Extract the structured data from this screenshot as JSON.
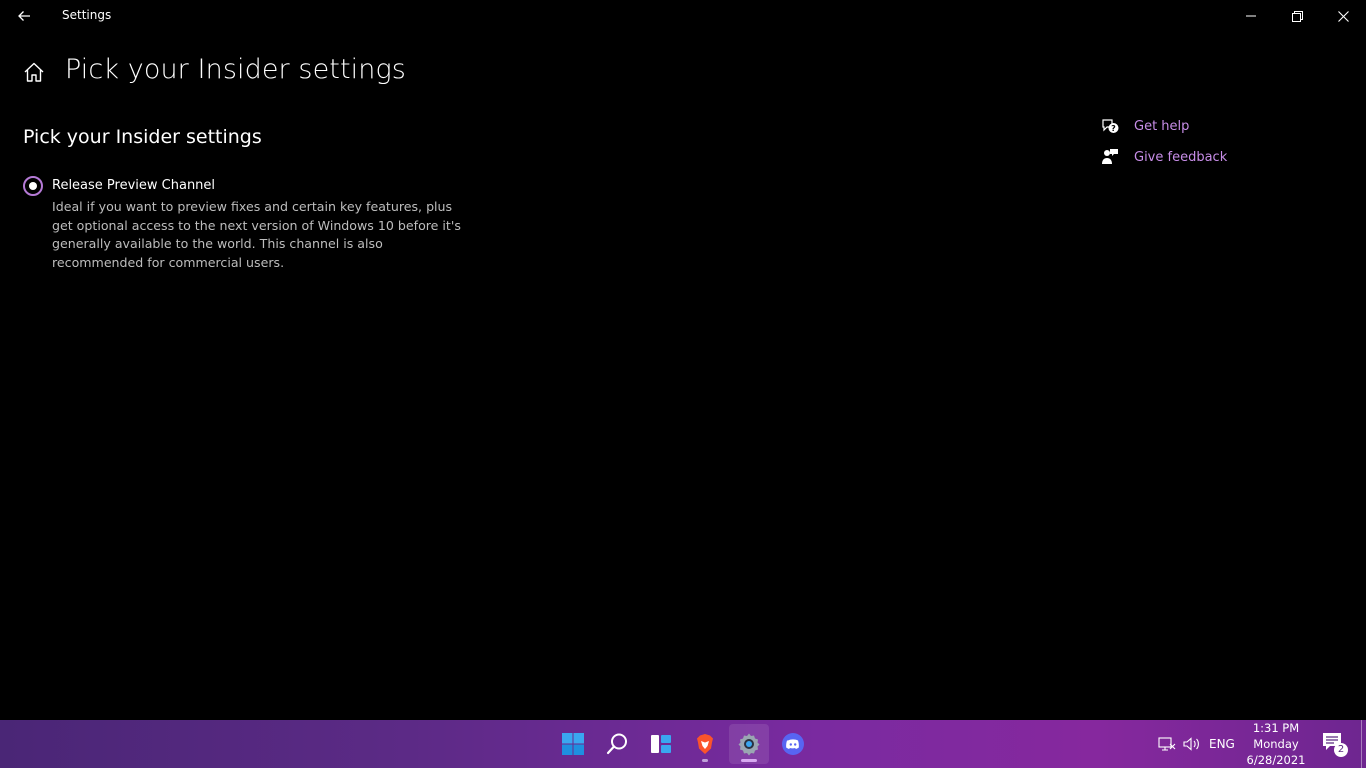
{
  "window": {
    "title": "Settings"
  },
  "page": {
    "title": "Pick your Insider settings",
    "section_title": "Pick your Insider settings"
  },
  "channel_option": {
    "label": "Release Preview Channel",
    "description": "Ideal if you want to preview fixes and certain key features, plus get optional access to the next version of Windows 10 before it's generally available to the world. This channel is also recommended for commercial users.",
    "selected": true
  },
  "related": {
    "get_help": "Get help",
    "give_feedback": "Give feedback"
  },
  "taskbar": {
    "icons": [
      "start-icon",
      "search-icon",
      "widgets-icon",
      "brave-browser-icon",
      "settings-gear-icon",
      "discord-icon"
    ],
    "language": "ENG",
    "time": "1:31 PM",
    "day": "Monday",
    "date": "6/28/2021",
    "notification_count": "2"
  },
  "colors": {
    "accent": "#c88ee8",
    "background": "#000000",
    "taskbar_start": "#4a2676",
    "taskbar_end": "#86289e"
  }
}
